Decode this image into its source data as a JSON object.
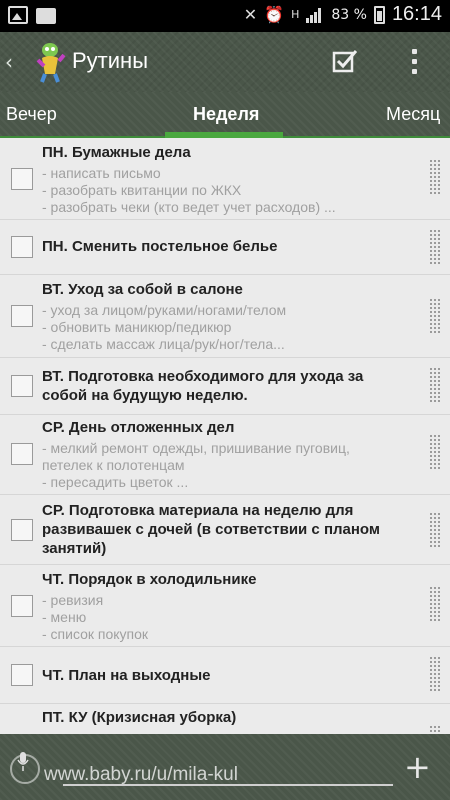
{
  "status_bar": {
    "battery_percent": "83 %",
    "time": "16:14",
    "network": "H"
  },
  "header": {
    "back_glyph": "‹",
    "title": "Рутины",
    "confirm_icon": "checkbox-check-icon",
    "overflow_icon": "overflow-menu-icon"
  },
  "tabs": [
    {
      "label": "Вечер",
      "active": false
    },
    {
      "label": "Неделя",
      "active": true
    },
    {
      "label": "Месяц",
      "active": false
    }
  ],
  "colors": {
    "bar": "#4a5649",
    "accent": "#4aa83f",
    "list_bg": "#ebebeb"
  },
  "items": [
    {
      "title": "ПН. Бумажные дела",
      "checked": false,
      "subs": [
        "- написать письмо",
        "- разобрать квитанции по ЖКХ",
        "- разобрать чеки (кто ведет учет расходов) ..."
      ]
    },
    {
      "title": "ПН. Сменить постельное белье",
      "checked": false,
      "subs": []
    },
    {
      "title": "ВТ. Уход за собой в салоне",
      "checked": false,
      "subs": [
        "- уход за лицом/руками/ногами/телом",
        "- обновить маникюр/педикюр",
        "- сделать массаж лица/рук/ног/тела..."
      ]
    },
    {
      "title": "ВТ. Подготовка необходимого для ухода за собой на будущую неделю.",
      "checked": false,
      "subs": []
    },
    {
      "title": "СР. День отложенных дел",
      "checked": false,
      "subs": [
        "- мелкий ремонт одежды, пришивание пуговиц,",
        "петелек к полотенцам",
        "- пересадить цветок ..."
      ]
    },
    {
      "title": "СР. Подготовка материала на неделю для развивашек с дочей (в сответствии с планом занятий)",
      "checked": false,
      "subs": []
    },
    {
      "title": "ЧТ. Порядок в холодильнике",
      "checked": false,
      "subs": [
        "- ревизия",
        "- меню",
        "- список покупок"
      ]
    },
    {
      "title": "ЧТ. План на выходные",
      "checked": false,
      "subs": []
    },
    {
      "title": "ПТ. КУ (Кризисная уборка)",
      "checked": false,
      "subs": []
    }
  ],
  "bottom_bar": {
    "watermark": "www.baby.ru/u/mila-kul",
    "add_glyph": "+"
  }
}
